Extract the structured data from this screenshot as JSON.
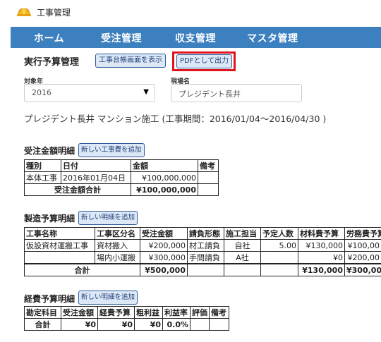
{
  "app": {
    "title": "工事管理",
    "icon": "helmet-icon"
  },
  "nav": {
    "items": [
      "ホーム",
      "受注管理",
      "収支管理",
      "マスタ管理"
    ],
    "bg_color": "#3d80bf"
  },
  "page": {
    "title": "実行予算管理",
    "ledger_button": "工事台帳画面を表示",
    "pdf_button": "PDFとして出力",
    "highlight_color": "#e0141c"
  },
  "filters": {
    "year_label": "対象年",
    "year_value": "2016",
    "site_label": "現場名",
    "site_value": "プレジデント長井"
  },
  "project_line": "プレジデント長井 マンション施工 (工事期間：2016/01/04～2016/04/30 )",
  "order_section": {
    "title": "受注金額明細",
    "add_button": "新しい工事費を追加",
    "headers": [
      "種別",
      "日付",
      "金額",
      "備考"
    ],
    "rows": [
      [
        "本体工事",
        "2016年01月04日",
        "¥100,000,000",
        ""
      ]
    ],
    "total_label": "受注金額合計",
    "total_value": "¥100,000,000"
  },
  "manufacturing_section": {
    "title": "製造予算明細",
    "add_button": "新しい明細を追加",
    "headers": [
      "工事名称",
      "工事区分名",
      "受注金額",
      "請負形態",
      "施工担当",
      "予定人数",
      "材料費予算",
      "労務費予算"
    ],
    "rows": [
      [
        "仮設資材運搬工事",
        "資材搬入",
        "¥200,000",
        "材工請負",
        "自社",
        "5.00",
        "¥130,000",
        "¥100,00"
      ],
      [
        "",
        "場内小運搬",
        "¥300,000",
        "手間請負",
        "A社",
        "",
        "¥0",
        "¥200,00"
      ]
    ],
    "total_label": "合計",
    "total_order": "¥500,000",
    "total_material": "¥130,000",
    "total_labor": "¥300,00"
  },
  "expense_section": {
    "title": "経費予算明細",
    "add_button": "新しい明細を追加",
    "headers": [
      "勘定科目",
      "受注金額",
      "経費予算",
      "粗利益",
      "利益率",
      "評価",
      "備考"
    ],
    "total_row": [
      "合計",
      "¥0",
      "¥0",
      "¥0",
      "0.0%",
      "",
      ""
    ]
  }
}
